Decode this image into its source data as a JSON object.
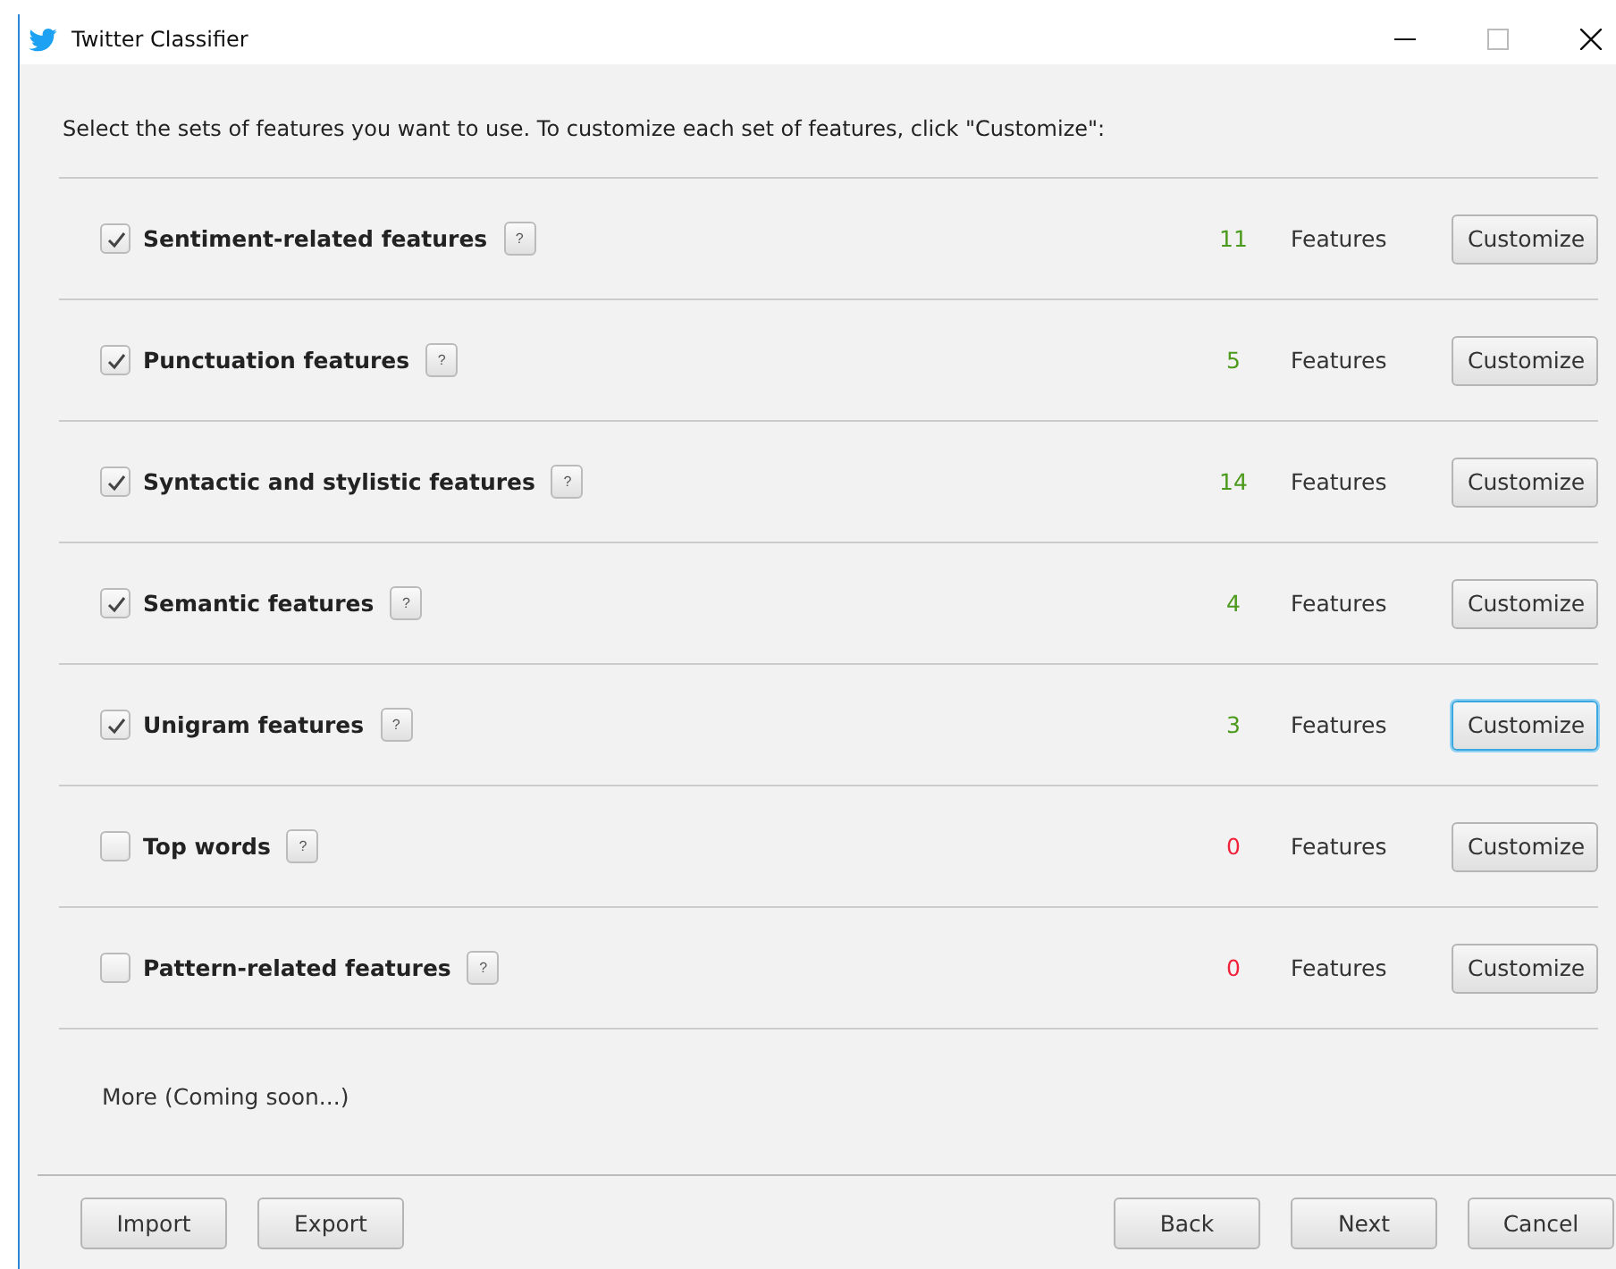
{
  "window": {
    "title": "Twitter Classifier"
  },
  "instruction": "Select the sets of features you want to use. To customize each set of features, click \"Customize\":",
  "feature_sets": [
    {
      "name": "Sentiment-related features",
      "checked": true,
      "help": "?",
      "count": "11",
      "color": "#4c9a1c",
      "unit": "Features",
      "button": "Customize",
      "focused": false
    },
    {
      "name": "Punctuation features",
      "checked": true,
      "help": "?",
      "count": "5",
      "color": "#4c9a1c",
      "unit": "Features",
      "button": "Customize",
      "focused": false
    },
    {
      "name": "Syntactic and stylistic features",
      "checked": true,
      "help": "?",
      "count": "14",
      "color": "#4c9a1c",
      "unit": "Features",
      "button": "Customize",
      "focused": false
    },
    {
      "name": "Semantic features",
      "checked": true,
      "help": "?",
      "count": "4",
      "color": "#4c9a1c",
      "unit": "Features",
      "button": "Customize",
      "focused": false
    },
    {
      "name": "Unigram features",
      "checked": true,
      "help": "?",
      "count": "3",
      "color": "#4c9a1c",
      "unit": "Features",
      "button": "Customize",
      "focused": true
    },
    {
      "name": "Top words",
      "checked": false,
      "help": "?",
      "count": "0",
      "color": "#f0243a",
      "unit": "Features",
      "button": "Customize",
      "focused": false
    },
    {
      "name": "Pattern-related features",
      "checked": false,
      "help": "?",
      "count": "0",
      "color": "#f0243a",
      "unit": "Features",
      "button": "Customize",
      "focused": false
    }
  ],
  "more": "More (Coming soon...)",
  "footer": {
    "left_buttons": [
      "Import",
      "Export"
    ],
    "right_buttons": [
      "Back",
      "Next",
      "Cancel"
    ]
  }
}
